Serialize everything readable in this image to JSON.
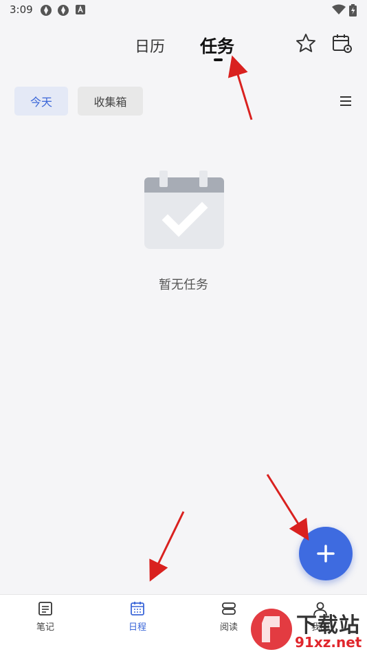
{
  "status_bar": {
    "time": "3:09",
    "left_icons": [
      "aperture-icon",
      "aperture-icon",
      "notification-a-icon"
    ],
    "right_icons": [
      "wifi-icon",
      "battery-icon"
    ]
  },
  "header": {
    "tabs": [
      {
        "label": "日历",
        "active": false
      },
      {
        "label": "任务",
        "active": true
      }
    ],
    "actions": [
      "star-icon",
      "calendar-settings-icon"
    ]
  },
  "filters": {
    "chips": [
      {
        "label": "今天",
        "selected": true
      },
      {
        "label": "收集箱",
        "selected": false
      }
    ],
    "menu_icon": "hamburger-menu-icon"
  },
  "empty_state": {
    "icon": "calendar-check-icon",
    "text": "暂无任务"
  },
  "fab": {
    "icon": "plus-icon"
  },
  "bottom_nav": {
    "items": [
      {
        "label": "笔记",
        "icon": "note-icon",
        "active": false
      },
      {
        "label": "日程",
        "icon": "schedule-icon",
        "active": true
      },
      {
        "label": "阅读",
        "icon": "reading-icon",
        "active": false
      },
      {
        "label": "我的",
        "icon": "profile-icon",
        "active": false
      }
    ]
  },
  "watermark": {
    "title": "下载站",
    "url": "91xz.net"
  },
  "colors": {
    "accent": "#3e6be0",
    "arrow": "#d9211f",
    "background": "#f5f5f7"
  }
}
